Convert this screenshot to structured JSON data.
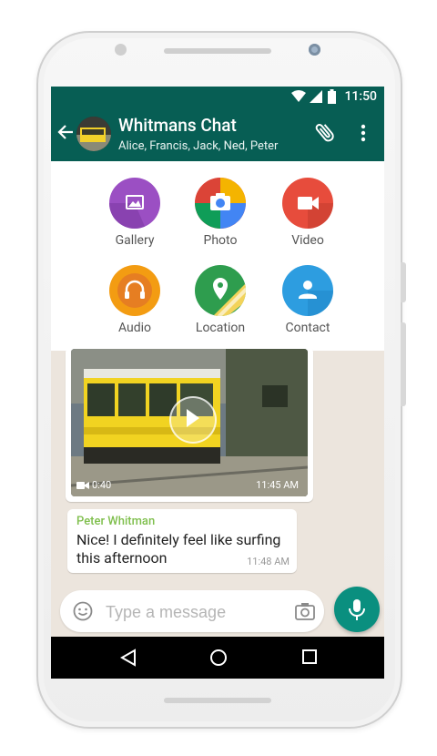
{
  "status_bar": {
    "time": "11:50"
  },
  "header": {
    "title": "Whitmans Chat",
    "participants": "Alice, Francis, Jack, Ned, Peter"
  },
  "attachments": [
    {
      "label": "Gallery",
      "color": "#9b4fc3",
      "icon": "image-icon"
    },
    {
      "label": "Photo",
      "color": "#e8453c",
      "icon": "camera-icon"
    },
    {
      "label": "Video",
      "color": "#e74c3c",
      "icon": "videocam-icon"
    },
    {
      "label": "Audio",
      "color": "#f39c12",
      "icon": "headphones-icon"
    },
    {
      "label": "Location",
      "color": "#2e9d4e",
      "icon": "map-pin-icon"
    },
    {
      "label": "Contact",
      "color": "#2d9de0",
      "icon": "person-icon"
    }
  ],
  "messages": {
    "video": {
      "duration": "0:40",
      "time": "11:45 AM"
    },
    "text": {
      "sender": "Peter Whitman",
      "body": "Nice! I definitely feel like surfing this afternoon",
      "time": "11:48 AM"
    }
  },
  "composer": {
    "placeholder": "Type a message"
  }
}
